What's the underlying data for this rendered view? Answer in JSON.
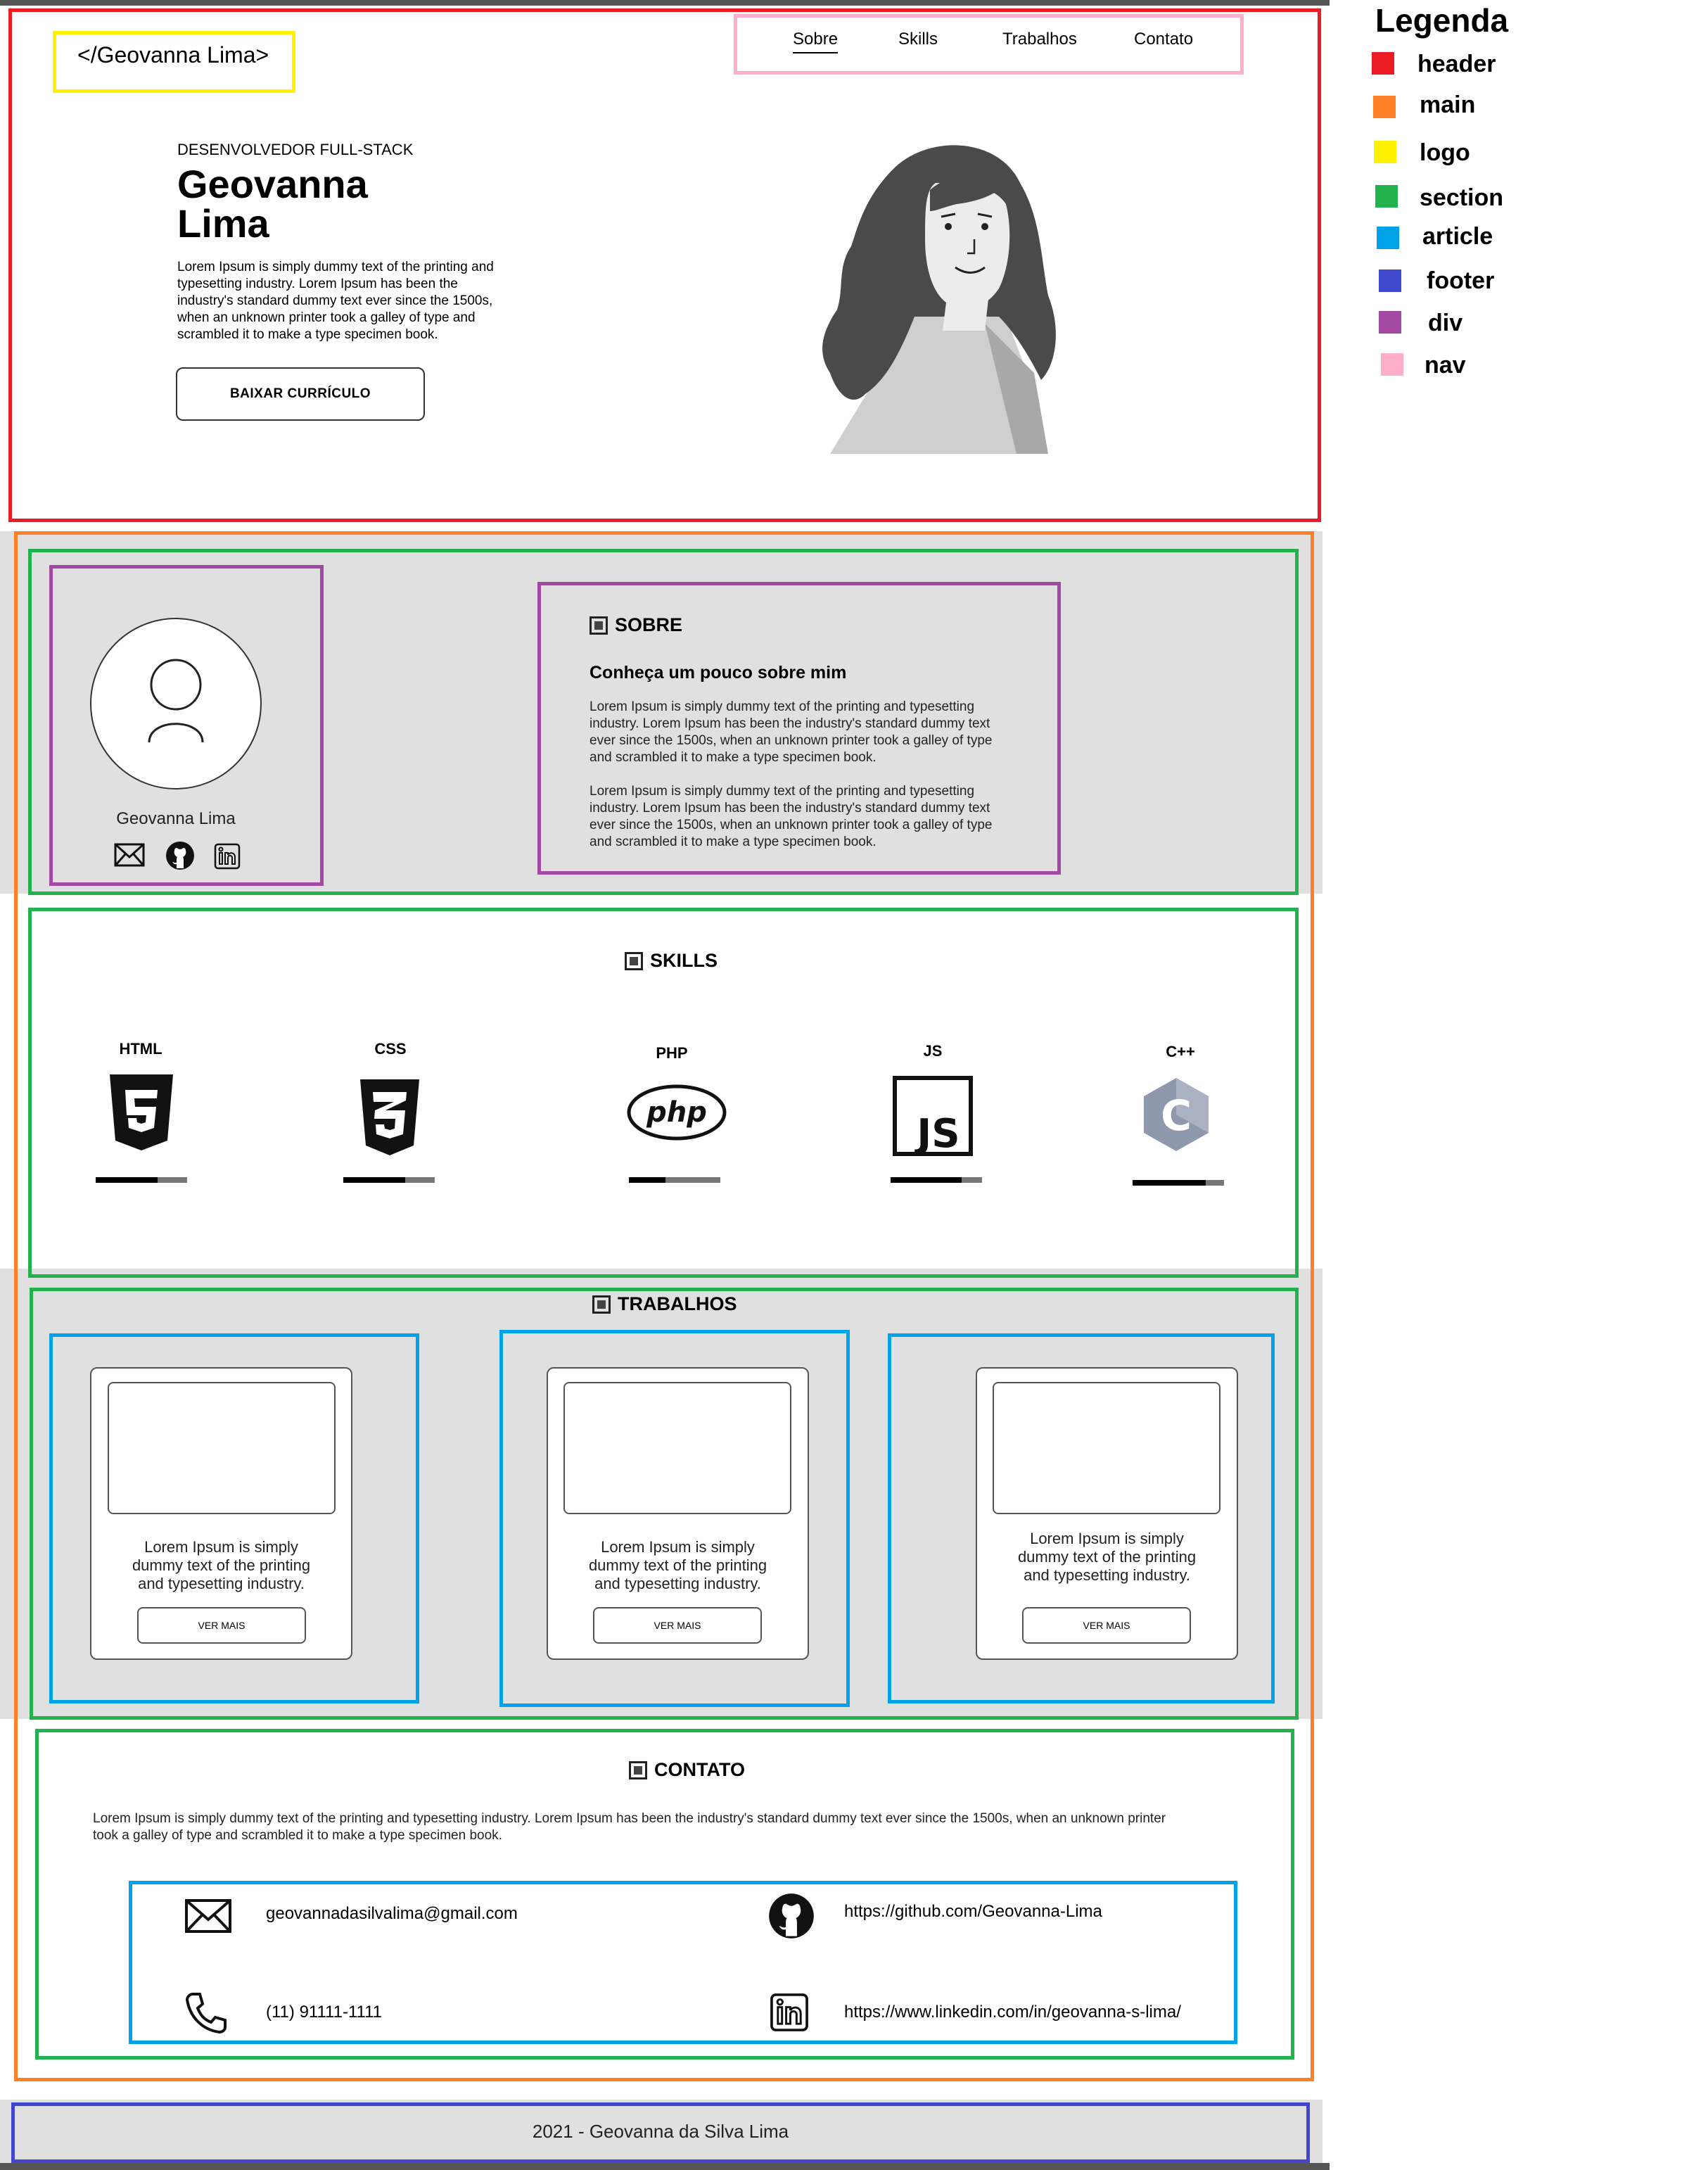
{
  "legend": {
    "title": "Legenda",
    "items": [
      {
        "label": "header",
        "color": "#ec1c24"
      },
      {
        "label": "main",
        "color": "#ff7f27"
      },
      {
        "label": "logo",
        "color": "#fff200"
      },
      {
        "label": "section",
        "color": "#22b14c"
      },
      {
        "label": "article",
        "color": "#00a2e8"
      },
      {
        "label": "footer",
        "color": "#3f48cc"
      },
      {
        "label": "div",
        "color": "#a349a4"
      },
      {
        "label": "nav",
        "color": "#ffaec9"
      }
    ]
  },
  "header": {
    "logo": "</Geovanna Lima>",
    "nav": [
      "Sobre",
      "Skills",
      "Trabalhos",
      "Contato"
    ],
    "subtitle": "DESENVOLVEDOR FULL-STACK",
    "name_line1": "Geovanna",
    "name_line2": "Lima",
    "text_lines": [
      "Lorem Ipsum is simply dummy text of the printing and",
      "typesetting industry. Lorem Ipsum has been the",
      "industry's standard dummy text ever since the 1500s,",
      "when an unknown printer took a galley of type and",
      "scrambled it to make a type specimen book."
    ],
    "button": "BAIXAR CURRÍCULO"
  },
  "about": {
    "profile_name": "Geovanna Lima",
    "title": "SOBRE",
    "subtitle": "Conheça um pouco sobre mim",
    "para1": [
      "Lorem Ipsum is simply dummy text of the printing and typesetting",
      "industry. Lorem Ipsum has been the industry's standard dummy text",
      "ever since the 1500s, when an unknown printer took a galley of type",
      "and scrambled it to make a type specimen book."
    ],
    "para2": [
      "Lorem Ipsum is simply dummy text of the printing and typesetting",
      "industry. Lorem Ipsum has been the industry's standard dummy text",
      "ever since the 1500s, when an unknown printer took a galley of type",
      "and scrambled it to make a type specimen book."
    ]
  },
  "skills": {
    "title": "SKILLS",
    "items": [
      {
        "label": "HTML",
        "icon": "html5-icon",
        "level": 0.68
      },
      {
        "label": "CSS",
        "icon": "css3-icon",
        "level": 0.68
      },
      {
        "label": "PHP",
        "icon": "php-icon",
        "level": 0.4
      },
      {
        "label": "JS",
        "icon": "js-icon",
        "level": 0.78
      },
      {
        "label": "C++",
        "icon": "cplusplus-icon",
        "level": 0.8
      }
    ]
  },
  "works": {
    "title": "TRABALHOS",
    "cards": [
      {
        "lines": [
          "Lorem Ipsum is simply",
          "dummy text of the printing",
          "and typesetting industry."
        ],
        "button": "VER MAIS"
      },
      {
        "lines": [
          "Lorem Ipsum is simply",
          "dummy text of the printing",
          "and typesetting industry."
        ],
        "button": "VER MAIS"
      },
      {
        "lines": [
          "Lorem Ipsum is simply",
          "dummy text of the printing",
          "and typesetting industry."
        ],
        "button": "VER MAIS"
      }
    ]
  },
  "contact": {
    "title": "CONTATO",
    "text_lines": [
      "Lorem Ipsum is simply dummy text of the printing and typesetting industry. Lorem Ipsum has been the industry's standard dummy text ever since the 1500s, when an unknown printer",
      "took a galley of type and scrambled it to make a type specimen book."
    ],
    "email": "geovannadasilvalima@gmail.com",
    "github": "https://github.com/Geovanna-Lima",
    "phone": "(11) 91111-1111",
    "linkedin": "https://www.linkedin.com/in/geovanna-s-lima/"
  },
  "footer": {
    "text": "2021 - Geovanna da Silva Lima"
  }
}
